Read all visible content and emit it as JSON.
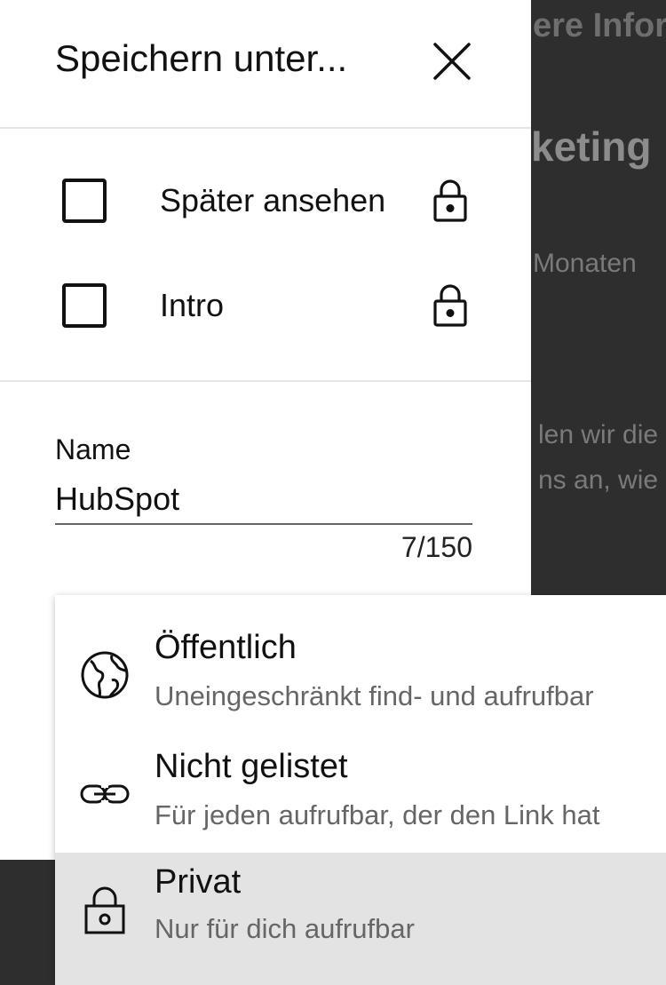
{
  "background": {
    "line1": "ere Infor",
    "line2": "keting",
    "line3": "Monaten",
    "line4": "len wir die",
    "line5": "ns an, wie"
  },
  "dialog": {
    "title": "Speichern unter...",
    "close_icon": "close-icon"
  },
  "playlists": [
    {
      "label": "Später ansehen",
      "checked": false,
      "icon": "lock-icon"
    },
    {
      "label": "Intro",
      "checked": false,
      "icon": "lock-icon"
    }
  ],
  "name_field": {
    "label": "Name",
    "value": "HubSpot",
    "counter": "7/150"
  },
  "privacy_menu": {
    "selected": "Privat",
    "options": [
      {
        "title": "Öffentlich",
        "subtitle": "Uneingeschränkt find- und aufrufbar",
        "icon": "globe-icon"
      },
      {
        "title": "Nicht gelistet",
        "subtitle": "Für jeden aufrufbar, der den Link hat",
        "icon": "link-icon"
      },
      {
        "title": "Privat",
        "subtitle": "Nur für dich aufrufbar",
        "icon": "lock-icon"
      }
    ]
  },
  "colors": {
    "scrim": "#2e2e2e",
    "selected_row": "#e3e3e3",
    "divider": "#e6e6e6"
  }
}
